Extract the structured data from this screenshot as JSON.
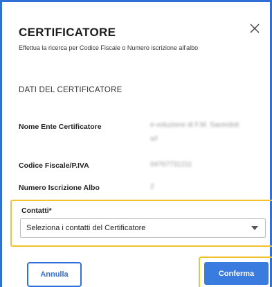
{
  "modal": {
    "title": "CERTIFICATORE",
    "subtitle": "Effettua la ricerca per Codice Fiscale o Numero iscrizione all'albo",
    "close_icon": "close-icon",
    "section_title": "DATI DEL CERTIFICATORE",
    "fields": [
      {
        "label": "Nome Ente Certificatore",
        "value_line1": "e-voluzione di F.M. Sacerdoti",
        "value_line2": "srl"
      },
      {
        "label": "Codice Fiscale/P.IVA",
        "value_line1": "04767731211"
      },
      {
        "label": "Numero Iscrizione Albo",
        "value_line1": "2"
      }
    ],
    "contacts": {
      "label": "Contatti*",
      "select_value": "Seleziona i contatti del Certificatore",
      "caret_icon": "chevron-down-icon"
    },
    "buttons": {
      "cancel": "Annulla",
      "confirm": "Conferma"
    }
  },
  "colors": {
    "primary": "#2f6fd6",
    "confirm_bg": "#3a7be0",
    "highlight": "#f2c230"
  }
}
